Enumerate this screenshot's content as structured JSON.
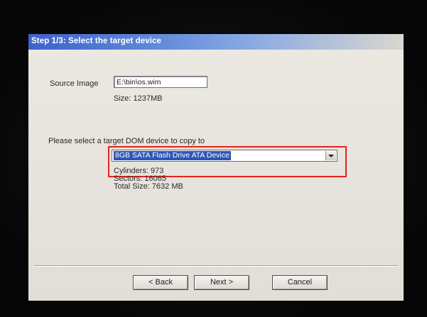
{
  "window": {
    "title": "Step 1/3: Select the target device"
  },
  "source": {
    "label": "Source Image",
    "path": "E:\\bin\\os.wim",
    "size": "Size: 1237MB"
  },
  "target": {
    "prompt": "Please select a target DOM device to copy to",
    "selected_device": "8GB SATA Flash Drive ATA Device",
    "cylinders": "Cylinders: 973",
    "sectors": "Sectors: 16065",
    "total_size": "Total Size: 7632 MB"
  },
  "buttons": {
    "back": "< Back",
    "next": "Next >",
    "cancel": "Cancel"
  },
  "colors": {
    "title_bar": "#3d63c9",
    "highlight": "#e3231f",
    "selection": "#2f56b8"
  }
}
